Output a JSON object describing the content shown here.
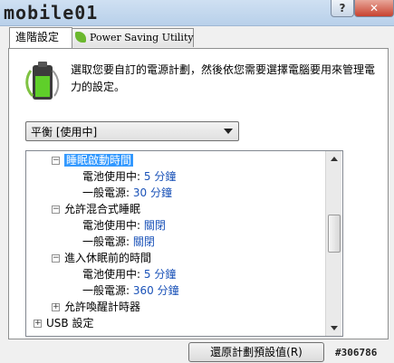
{
  "window": {
    "logo_text": "mobile01",
    "help_label": "?",
    "close_label": "✕"
  },
  "tabs": [
    {
      "label": "進階設定"
    },
    {
      "label": "Power Saving Utility"
    }
  ],
  "description": "選取您要自訂的電源計劃，然後依您需要選擇電腦要用來管理電力的設定。",
  "plan_select": {
    "selected": "平衡 [使用中]"
  },
  "tree": {
    "sleep_after": {
      "label": "睡眠啟動時間",
      "battery_label": "電池使用中:",
      "battery_value": "5 分鐘",
      "ac_label": "一般電源:",
      "ac_value": "30 分鐘"
    },
    "hybrid_sleep": {
      "label": "允許混合式睡眠",
      "battery_label": "電池使用中:",
      "battery_value": "關閉",
      "ac_label": "一般電源:",
      "ac_value": "關閉"
    },
    "hibernate_after": {
      "label": "進入休眠前的時間",
      "battery_label": "電池使用中:",
      "battery_value": "5 分鐘",
      "ac_label": "一般電源:",
      "ac_value": "360 分鐘"
    },
    "wake_timers": {
      "label": "允許喚醒計時器"
    },
    "usb": {
      "label": "USB 設定"
    }
  },
  "restore_button": "還原計劃預設值(R)",
  "watermark": "#306786",
  "icons": {
    "battery": "battery-power-icon",
    "leaf": "leaf-icon"
  },
  "colors": {
    "selection": "#3399ff",
    "link": "#1a52b8"
  }
}
